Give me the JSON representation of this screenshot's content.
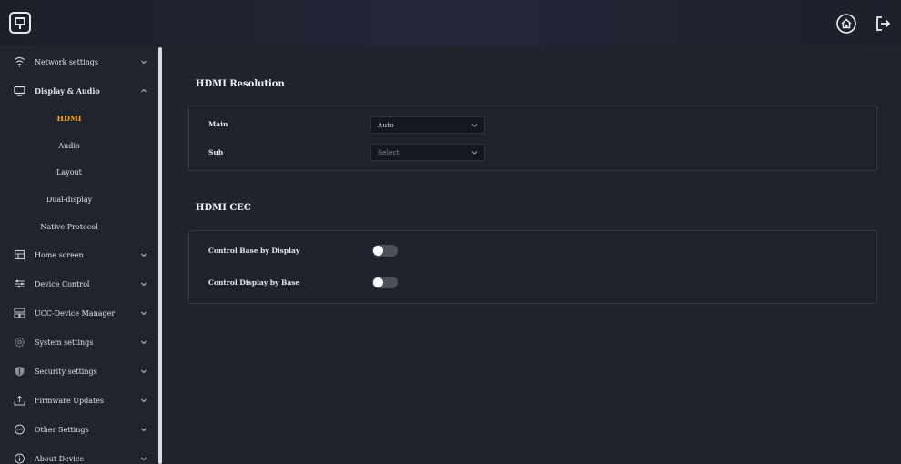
{
  "topbar": {
    "home_icon": "home-icon",
    "logout_icon": "logout-icon"
  },
  "sidebar": {
    "items": [
      {
        "label": "Network settings",
        "icon": "wifi-icon"
      },
      {
        "label": "Display & Audio",
        "icon": "monitor-icon",
        "expanded": true
      },
      {
        "label": "Home screen",
        "icon": "home-screen-icon"
      },
      {
        "label": "Device Control",
        "icon": "sliders-icon"
      },
      {
        "label": "UCC-Device Manager",
        "icon": "device-manager-icon"
      },
      {
        "label": "System settings",
        "icon": "gear-icon"
      },
      {
        "label": "Security settings",
        "icon": "shield-icon"
      },
      {
        "label": "Firmware Updates",
        "icon": "upload-icon"
      },
      {
        "label": "Other Settings",
        "icon": "more-icon"
      },
      {
        "label": "About Device",
        "icon": "info-icon"
      }
    ],
    "subitems": [
      {
        "label": "HDMI",
        "active": true
      },
      {
        "label": "Audio"
      },
      {
        "label": "Layout"
      },
      {
        "label": "Dual-display"
      },
      {
        "label": "Native Protocol"
      }
    ]
  },
  "main": {
    "hdmi_resolution": {
      "title": "HDMI Resolution",
      "main_label": "Main",
      "main_value": "Auto",
      "sub_label": "Sub",
      "sub_placeholder": "Select"
    },
    "hdmi_cec": {
      "title": "HDMI CEC",
      "toggle1_label": "Control Base by Display",
      "toggle1_on": false,
      "toggle2_label": "Control Display by Base",
      "toggle2_on": false
    }
  },
  "colors": {
    "accent": "#f5a623",
    "background": "#1f232c"
  }
}
